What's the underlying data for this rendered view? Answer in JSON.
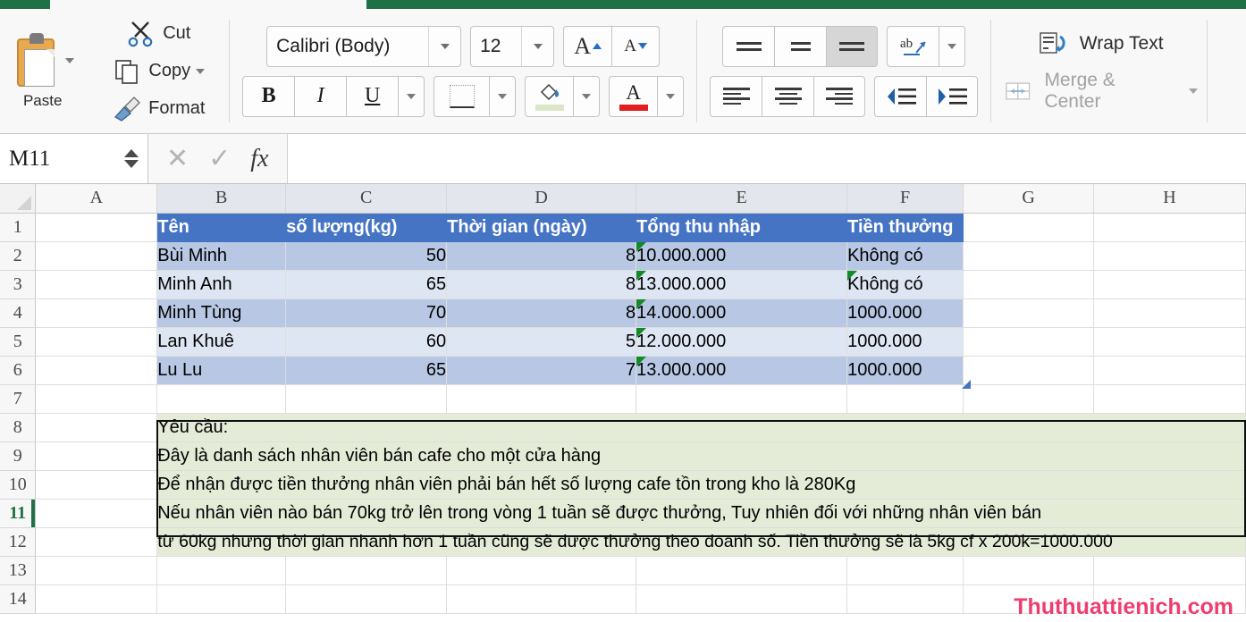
{
  "ribbon": {
    "paste": {
      "label": "Paste",
      "icon": "clipboard-icon"
    },
    "clipboard_items": [
      {
        "label": "Cut",
        "icon": "scissors-icon"
      },
      {
        "label": "Copy",
        "icon": "copy-icon"
      },
      {
        "label": "Format",
        "icon": "format-painter-icon"
      }
    ],
    "font": {
      "name": "Calibri (Body)",
      "size": "12",
      "grow_label": "A",
      "shrink_label": "A",
      "bold": "B",
      "italic": "I",
      "underline": "U",
      "font_color_swatch": "#e02020",
      "fill_color_swatch": "#dbe5c8"
    },
    "alignment": {
      "orientation_label": "ab",
      "active_vertical": "align-bottom"
    },
    "wrap_text_label": "Wrap Text",
    "merge_center_label": "Merge & Center"
  },
  "formula_bar": {
    "name_box": "M11",
    "cancel_icon": "✕",
    "enter_icon": "✓",
    "fx_icon": "fx",
    "value": ""
  },
  "grid": {
    "columns": [
      "A",
      "B",
      "C",
      "D",
      "E",
      "F",
      "G",
      "H"
    ],
    "selected_columns": [
      "B",
      "C",
      "D",
      "E",
      "F"
    ],
    "active_row": "11",
    "rows": [
      "1",
      "2",
      "3",
      "4",
      "5",
      "6",
      "7",
      "8",
      "9",
      "10",
      "11",
      "12",
      "13",
      "14"
    ],
    "table": {
      "headers": [
        "Tên",
        "số lượng(kg)",
        "Thời gian (ngày)",
        "Tổng thu nhập",
        "Tiền thưởng"
      ],
      "data": [
        {
          "ten": "Bùi Minh",
          "so_luong": "50",
          "thoi_gian": "8",
          "tong_thu_nhap": "10.000.000",
          "tien_thuong": "Không có",
          "err_income": true,
          "err_bonus": false
        },
        {
          "ten": "Minh Anh",
          "so_luong": "65",
          "thoi_gian": "8",
          "tong_thu_nhap": "13.000.000",
          "tien_thuong": "Không có",
          "err_income": true,
          "err_bonus": true
        },
        {
          "ten": "Minh Tùng",
          "so_luong": "70",
          "thoi_gian": "8",
          "tong_thu_nhap": "14.000.000",
          "tien_thuong": "1000.000",
          "err_income": true,
          "err_bonus": false
        },
        {
          "ten": "Lan Khuê",
          "so_luong": "60",
          "thoi_gian": "5",
          "tong_thu_nhap": "12.000.000",
          "tien_thuong": "1000.000",
          "err_income": true,
          "err_bonus": false
        },
        {
          "ten": "Lu Lu",
          "so_luong": "65",
          "thoi_gian": "7",
          "tong_thu_nhap": "13.000.000",
          "tien_thuong": "1000.000",
          "err_income": true,
          "err_bonus": false
        }
      ]
    },
    "notes": [
      "Yêu cầu:",
      "Đây là danh sách nhân viên bán cafe cho một cửa hàng",
      "Để nhận được tiền thưởng nhân viên phải bán hết số lượng cafe tồn trong kho là 280Kg",
      "Nếu nhân viên nào bán 70kg trở lên trong vòng 1 tuần sẽ được thưởng, Tuy nhiên đối với những nhân viên bán",
      "từ 60kg nhưng thời gian nhanh hơn 1 tuần cũng sẽ được thưởng theo doanh số. Tiền thưởng sẽ là 5kg cf x 200k=1000.000"
    ]
  },
  "watermark": "Thuthuattienich.com",
  "colors": {
    "ribbon_tab_green": "#1e7145",
    "table_header_blue": "#4574c4",
    "band_dark": "#b8c8e4",
    "band_light": "#dee6f3",
    "note_green": "#e4ecd8",
    "watermark_pink": "#ef3e6d",
    "error_triangle_green": "#128a28"
  }
}
